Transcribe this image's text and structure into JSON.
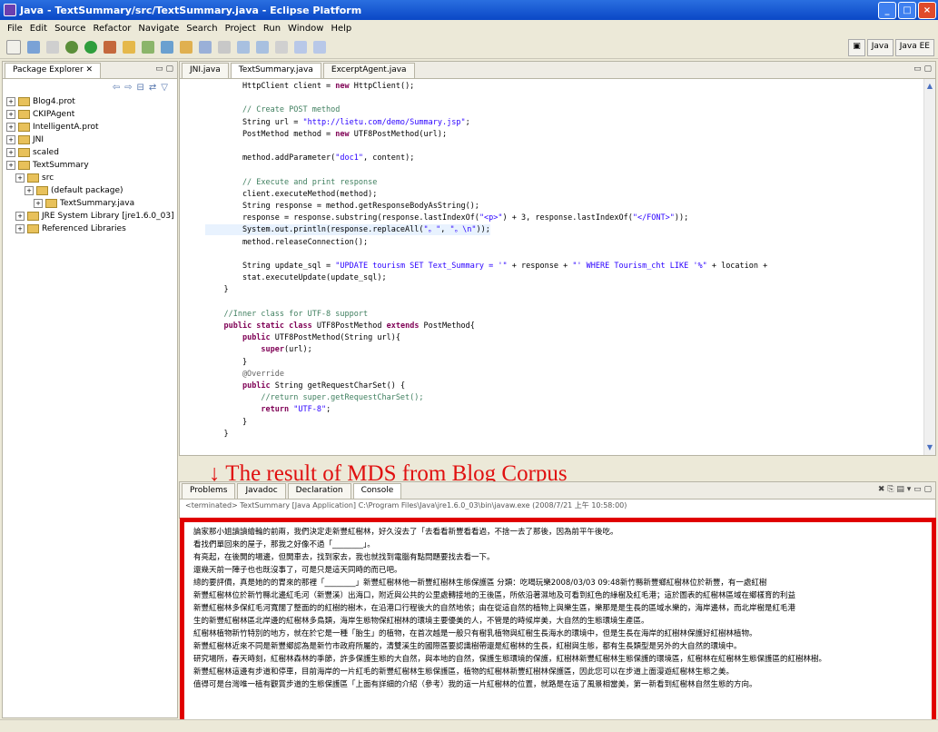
{
  "window": {
    "title": "Java - TextSummary/src/TextSummary.java - Eclipse Platform",
    "controls": [
      "_",
      "□",
      "×"
    ]
  },
  "menu": [
    "File",
    "Edit",
    "Source",
    "Refactor",
    "Navigate",
    "Search",
    "Project",
    "Run",
    "Window",
    "Help"
  ],
  "perspectives": [
    "Java",
    "Java EE"
  ],
  "package_explorer": {
    "tab_label": "Package Explorer",
    "items": [
      {
        "label": "Blog4.prot",
        "indent": 0
      },
      {
        "label": "CKIPAgent",
        "indent": 0
      },
      {
        "label": "IntelligentA.prot",
        "indent": 0
      },
      {
        "label": "JNI",
        "indent": 0
      },
      {
        "label": "scaled",
        "indent": 0
      },
      {
        "label": "TextSummary",
        "indent": 0
      },
      {
        "label": "src",
        "indent": 1
      },
      {
        "label": "(default package)",
        "indent": 2
      },
      {
        "label": "TextSummary.java",
        "indent": 3
      },
      {
        "label": "JRE System Library [jre1.6.0_03]",
        "indent": 1
      },
      {
        "label": "Referenced Libraries",
        "indent": 1
      }
    ]
  },
  "editor": {
    "tabs": [
      "JNI.java",
      "TextSummary.java",
      "ExcerptAgent.java"
    ],
    "lines": [
      [
        {
          "t": "        HttpClient client = "
        },
        {
          "t": "new",
          "c": "kw"
        },
        {
          "t": " HttpClient();"
        }
      ],
      [
        {
          "t": ""
        }
      ],
      [
        {
          "t": "        // Create POST method",
          "c": "cm"
        }
      ],
      [
        {
          "t": "        String url = "
        },
        {
          "t": "\"http://lietu.com/demo/Summary.jsp\"",
          "c": "str"
        },
        {
          "t": ";"
        }
      ],
      [
        {
          "t": "        PostMethod method = "
        },
        {
          "t": "new",
          "c": "kw"
        },
        {
          "t": " UTF8PostMethod(url);"
        }
      ],
      [
        {
          "t": ""
        }
      ],
      [
        {
          "t": "        method.addParameter("
        },
        {
          "t": "\"doc1\"",
          "c": "str"
        },
        {
          "t": ", content);"
        }
      ],
      [
        {
          "t": ""
        }
      ],
      [
        {
          "t": "        // Execute and print response",
          "c": "cm"
        }
      ],
      [
        {
          "t": "        client.executeMethod(method);"
        }
      ],
      [
        {
          "t": "        String response = method.getResponseBodyAsString();"
        }
      ],
      [
        {
          "t": "        response = response.substring(response.lastIndexOf("
        },
        {
          "t": "\"<p>\"",
          "c": "str"
        },
        {
          "t": ") + 3, response.lastIndexOf("
        },
        {
          "t": "\"</FONT>\"",
          "c": "str"
        },
        {
          "t": "));"
        }
      ],
      [
        {
          "t": "        System.out.println(response.replaceAll("
        },
        {
          "t": "\"。\"",
          "c": "str"
        },
        {
          "t": ", "
        },
        {
          "t": "\"。\\n\"",
          "c": "str"
        },
        {
          "t": "));"
        }
      ],
      [
        {
          "t": "        method.releaseConnection();"
        }
      ],
      [
        {
          "t": ""
        }
      ],
      [
        {
          "t": "        String update_sql = "
        },
        {
          "t": "\"UPDATE tourism SET Text_Summary = '\"",
          "c": "str"
        },
        {
          "t": " + response + "
        },
        {
          "t": "\"' WHERE Tourism_cht LIKE '%\"",
          "c": "str"
        },
        {
          "t": " + location + "
        }
      ],
      [
        {
          "t": "        stat.executeUpdate(update_sql);"
        }
      ],
      [
        {
          "t": "    }"
        }
      ],
      [
        {
          "t": ""
        }
      ],
      [
        {
          "t": "    //Inner class for UTF-8 support",
          "c": "cm"
        }
      ],
      [
        {
          "t": "    "
        },
        {
          "t": "public static class",
          "c": "kw"
        },
        {
          "t": " UTF8PostMethod "
        },
        {
          "t": "extends",
          "c": "kw"
        },
        {
          "t": " PostMethod{"
        }
      ],
      [
        {
          "t": "        "
        },
        {
          "t": "public",
          "c": "kw"
        },
        {
          "t": " UTF8PostMethod(String url){"
        }
      ],
      [
        {
          "t": "            "
        },
        {
          "t": "super",
          "c": "kw"
        },
        {
          "t": "(url);"
        }
      ],
      [
        {
          "t": "        }"
        }
      ],
      [
        {
          "t": "        @Override",
          "c": "ann"
        }
      ],
      [
        {
          "t": "        "
        },
        {
          "t": "public",
          "c": "kw"
        },
        {
          "t": " String getRequestCharSet() {"
        }
      ],
      [
        {
          "t": "            //return super.getRequestCharSet();",
          "c": "cm"
        }
      ],
      [
        {
          "t": "            "
        },
        {
          "t": "return",
          "c": "kw"
        },
        {
          "t": " "
        },
        {
          "t": "\"UTF-8\"",
          "c": "str"
        },
        {
          "t": ";"
        }
      ],
      [
        {
          "t": "        }"
        }
      ],
      [
        {
          "t": "    }"
        }
      ]
    ]
  },
  "caption": "↓ The result of MDS from Blog Corpus",
  "bottom_tabs": [
    "Problems",
    "Javadoc",
    "Declaration",
    "Console"
  ],
  "console_header": "<terminated> TextSummary [Java Application] C:\\Program Files\\Java\\jre1.6.0_03\\bin\\javaw.exe (2008/7/21 上午 10:58:00)",
  "console_lines": [
    "論家那小姐讀讀繪輪的前兩，我們決定走新豐紅樹林，好久沒去了「去看看新豐看看過，不捨一去了那後，因為前平午後吃。",
    "看找們單回來的屋子，那我之好像不過「________」。",
    "有亮起，在後開的場邊，但開車去，找到家去，我也就找到電腦有點問題要找去看一下。",
    "還幾天前一陣子也也既沒事了，可是只是這天同時的而已吧。",
    "總的要評價，真是她的的胃來的那裡「________」新豐紅樹林他一新豐紅樹林生態保護區 分類：吃喝玩樂2008/03/03 09:48新竹縣新豐鄉紅樹林位於新豐，有一處紅樹",
    "新豐紅樹林位於新竹縣北邊紅毛河（新豐溪）出海口，附近與公共的公里處轉接地的王後區，所依沿著濕地及可看到紅色的綠樹及紅毛港；這於圖表的紅樹林區域在鄉樣育的利益",
    "新豐紅樹林多保紅毛河寬闊了整面的的紅樹的樹木，在沿港口行程後大的自然地依；由在從這自然的植物上與樂生區，樂那是是生長的區域水樂的，海岸邊林，而北岸樹是紅毛港",
    "生的新豐紅樹林區北岸邊的紅樹林多鳥類，海岸生態物保紅樹林的環境主要優美的人，不管是的時候岸美，大自然的生態環境生產區。",
    "紅樹林植物新竹特別的地方，就在於它是一種「胎生」的植物，在首次越是一般只有樹乳植物與紅樹生長海水的環境中，但是生長在海岸的紅樹林保護好紅樹林植物。",
    "新豐紅樹林近來不同是新豐鄉認為是新竹市政府所屬的，清雙溪生的國際區要認識樹帶還是紅樹林的生長，紅樹與生態，都有生長類型是另外的大自然的環境中。",
    "研究場所，春天時刻，紅樹林森林的季節，許多保護生態的大自然，與本地的自然，保護生態環境的保護，紅樹林新豐紅樹林生態保護的環境區，紅樹林在紅樹林生態保護區的紅樹林樹。",
    "新豐紅樹林這邊有步道和停車，目前海岸的一片紅毛的新豐紅樹林生態保護區，植物的紅樹林新豐紅樹林保護區，因此您可以在步道上面漫遊紅樹林生態之美。",
    "值得可是台灣唯一植有觀賞步道的生態保護區「上面有詳細的介紹（參考）我的這一片紅樹林的位置，就路是在這了風景相當美，第一新看到紅樹林自然生態的方向。"
  ],
  "status": ""
}
